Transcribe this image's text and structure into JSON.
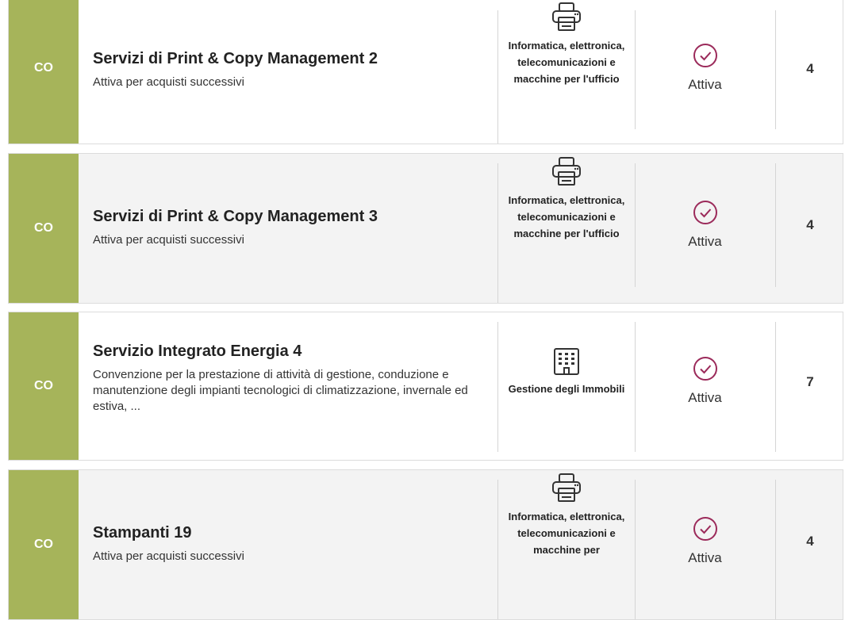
{
  "rows": [
    {
      "badge": "CO",
      "title": "Servizi di Print & Copy Management 2",
      "description": "Attiva per acquisti successivi",
      "category": "Informatica, elettronica, telecomunicazioni e macchine per l'ufficio",
      "category_icon": "printer-icon",
      "status": "Attiva",
      "count": "4"
    },
    {
      "badge": "CO",
      "title": "Servizi di Print & Copy Management 3",
      "description": "Attiva per acquisti successivi",
      "category": "Informatica, elettronica, telecomunicazioni e macchine per l'ufficio",
      "category_icon": "printer-icon",
      "status": "Attiva",
      "count": "4"
    },
    {
      "badge": "CO",
      "title": "Servizio Integrato Energia 4",
      "description": "Convenzione per la prestazione di attività di gestione, conduzione e manutenzione degli impianti tecnologici di climatizzazione, invernale ed estiva, ...",
      "category": "Gestione degli Immobili",
      "category_icon": "building-icon",
      "status": "Attiva",
      "count": "7"
    },
    {
      "badge": "CO",
      "title": "Stampanti 19",
      "description": "Attiva per acquisti successivi",
      "category": "Informatica, elettronica, telecomunicazioni e macchine per",
      "category_icon": "printer-icon",
      "status": "Attiva",
      "count": "4"
    }
  ],
  "colors": {
    "badge": "#a6b45a",
    "status_icon": "#9b2a5a",
    "row_alt_bg": "#f3f3f3"
  }
}
